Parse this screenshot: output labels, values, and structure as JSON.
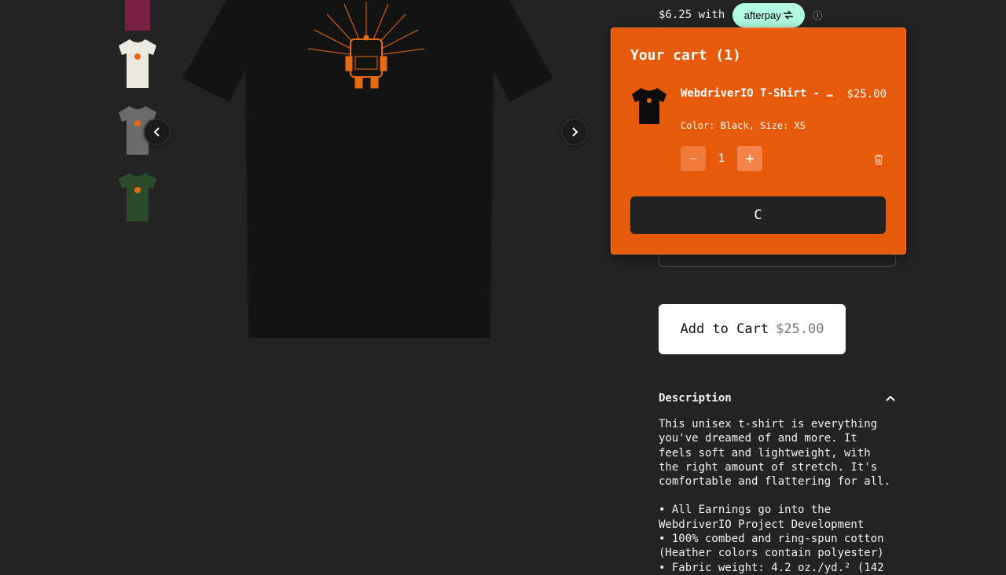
{
  "product": {
    "name_truncated": "WebdriverIO T-Shirt - R…",
    "thumbnails": [
      {
        "name": "maroon",
        "color": "#7a1f45"
      },
      {
        "name": "white",
        "color": "#ece9e0"
      },
      {
        "name": "grey",
        "color": "#6b6b6b"
      },
      {
        "name": "forest-green",
        "color": "#2a4a2a"
      }
    ],
    "main_image_color": "#121212",
    "logo_color": "#e86a10"
  },
  "afterpay": {
    "installment": "$6.25 with",
    "badge_label": "afterpay",
    "info_glyph": "ⓘ"
  },
  "cart": {
    "title": "Your cart (1)",
    "item": {
      "name": "WebdriverIO T-Shirt - R…",
      "price": "$25.00",
      "variant": "Color: Black, Size: XS",
      "quantity": "1"
    },
    "checkout_label": "C",
    "accent": "#e65a09"
  },
  "add_to_cart": {
    "label": "Add to Cart",
    "price": "$25.00"
  },
  "description": {
    "title": "Description",
    "intro": "This unisex t-shirt is everything\nyou've dreamed of and more. It\nfeels soft and lightweight, with\nthe right amount of stretch. It's\ncomfortable and flattering for all.",
    "bullets": [
      "All Earnings go into the\nWebdriverIO Project Development",
      "100% combed and ring-spun cotton\n(Heather colors contain polyester)",
      "Fabric weight: 4.2 oz./yd.² (142"
    ]
  }
}
